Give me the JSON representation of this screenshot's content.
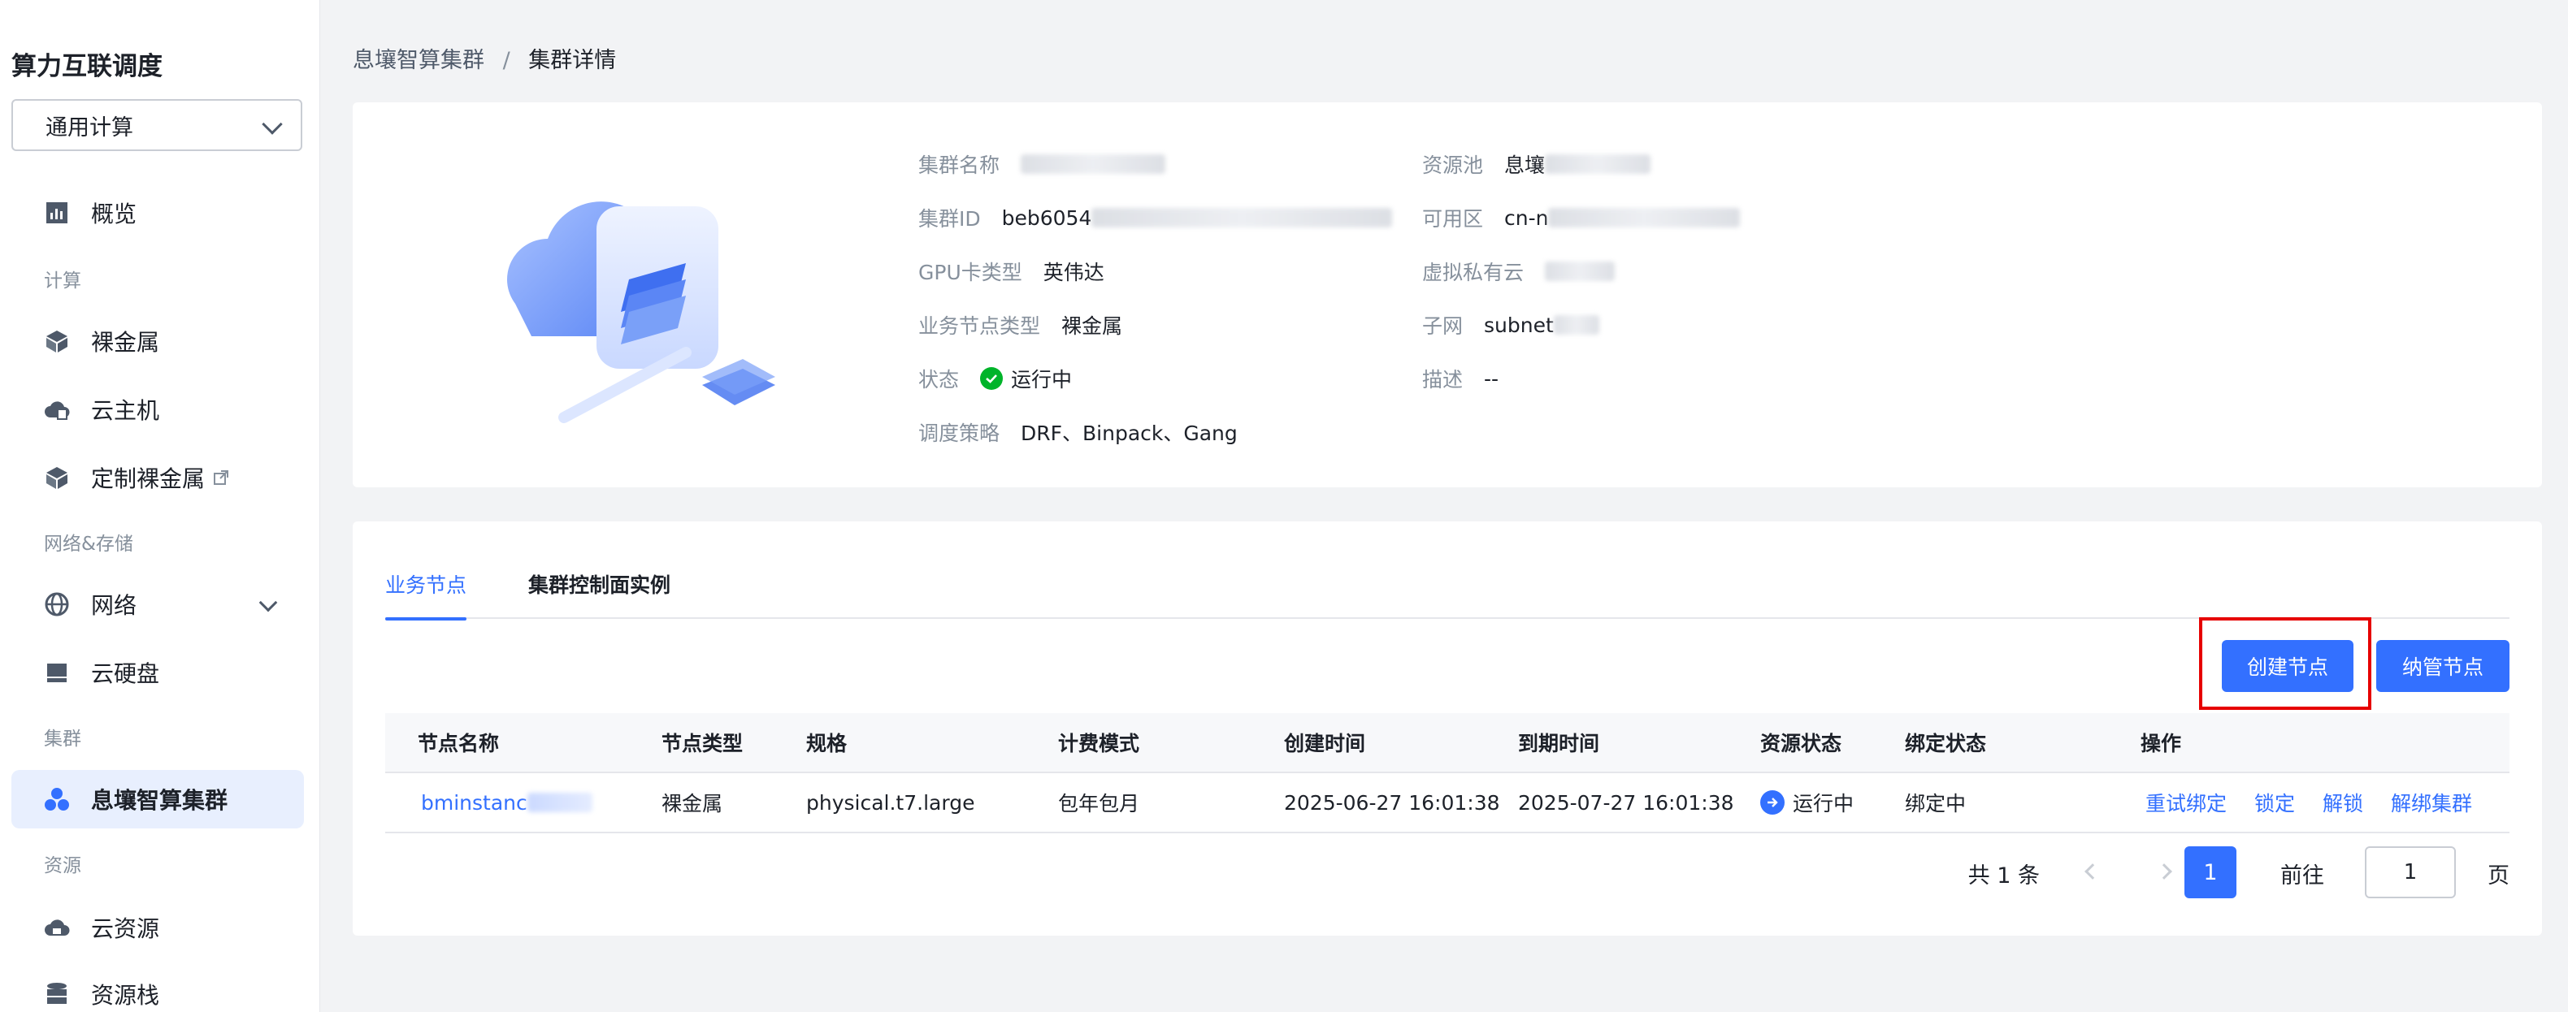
{
  "sidebar": {
    "app_title": "算力互联调度",
    "scope_select": "通用计算",
    "items": [
      {
        "label": "概览",
        "icon": "overview-chart-icon"
      },
      {
        "section": "计算"
      },
      {
        "label": "裸金属",
        "icon": "cube-icon"
      },
      {
        "label": "云主机",
        "icon": "cloud-server-icon"
      },
      {
        "label": "定制裸金属",
        "icon": "cube-icon",
        "external": true
      },
      {
        "section": "网络&存储"
      },
      {
        "label": "网络",
        "icon": "globe-icon"
      },
      {
        "label": "云硬盘",
        "icon": "disk-icon"
      },
      {
        "section": "集群"
      },
      {
        "label": "息壤智算集群",
        "icon": "cluster-icon",
        "active": true
      },
      {
        "section": "资源"
      },
      {
        "label": "云资源",
        "icon": "cloud-resource-icon"
      },
      {
        "label": "资源栈",
        "icon": "database-icon"
      }
    ]
  },
  "breadcrumb": {
    "parent": "息壤智算集群",
    "separator": "/",
    "current": "集群详情"
  },
  "cluster_info": {
    "name_label": "集群名称",
    "id_label": "集群ID",
    "id_value": "beb6054",
    "gpu_label": "GPU卡类型",
    "gpu_value": "英伟达",
    "node_type_label": "业务节点类型",
    "node_type_value": "裸金属",
    "status_label": "状态",
    "status_value": "运行中",
    "policy_label": "调度策略",
    "policy_value": "DRF、Binpack、Gang",
    "pool_label": "资源池",
    "pool_value": "息壤",
    "zone_label": "可用区",
    "zone_value": "cn-n",
    "vpc_label": "虚拟私有云",
    "subnet_label": "子网",
    "subnet_value": "subnet",
    "desc_label": "描述",
    "desc_value": "--"
  },
  "tabs": [
    {
      "label": "业务节点",
      "active": true
    },
    {
      "label": "集群控制面实例",
      "active": false
    }
  ],
  "actions": {
    "create_node": "创建节点",
    "manage_node": "纳管节点"
  },
  "table": {
    "columns": [
      "节点名称",
      "节点类型",
      "规格",
      "计费模式",
      "创建时间",
      "到期时间",
      "资源状态",
      "绑定状态",
      "操作"
    ],
    "rows": [
      {
        "name": "bminstanc",
        "type": "裸金属",
        "spec": "physical.t7.large",
        "billing": "包年包月",
        "created": "2025-06-27 16:01:38",
        "expires": "2025-07-27 16:01:38",
        "resource_status": "运行中",
        "bind_status": "绑定中",
        "ops": [
          "重试绑定",
          "锁定",
          "解锁",
          "解绑集群"
        ]
      }
    ]
  },
  "pagination": {
    "total": "共 1 条",
    "current_page": "1",
    "goto_label": "前往",
    "goto_value": "1",
    "page_unit": "页"
  },
  "colors": {
    "primary": "#3370ff",
    "success": "#00b42a",
    "highlight": "#e60000"
  }
}
